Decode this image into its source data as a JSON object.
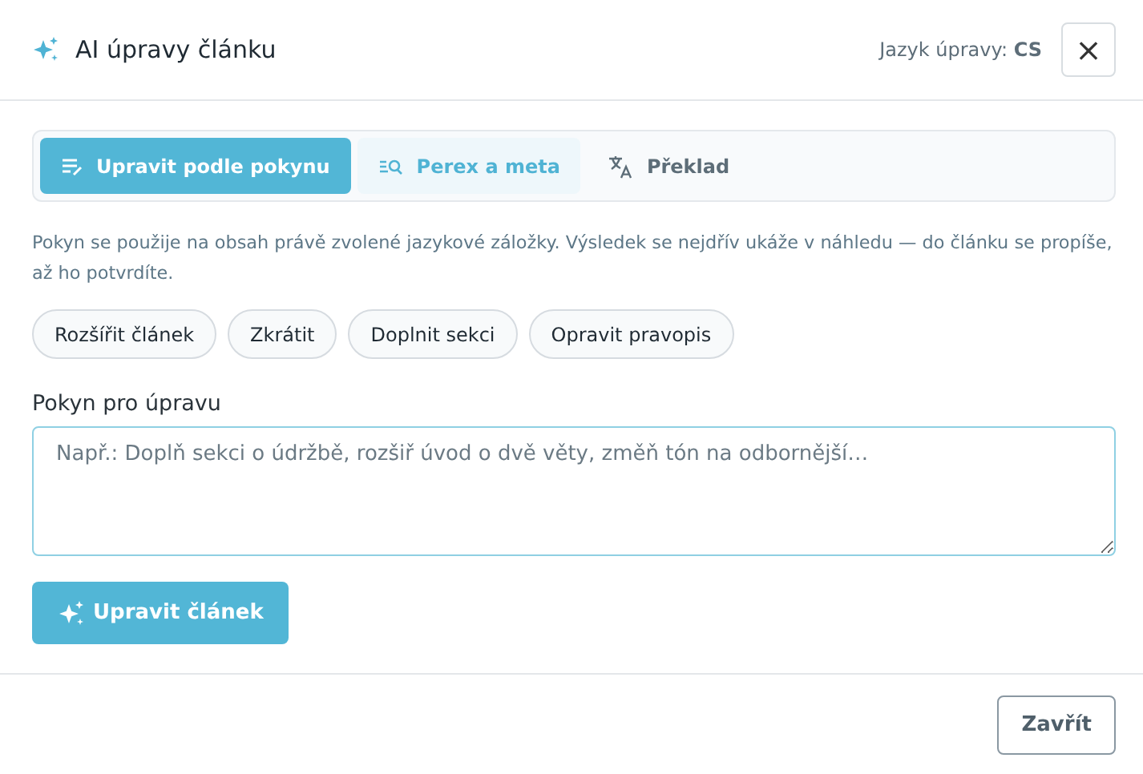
{
  "header": {
    "title": "AI úpravy článku",
    "language_label": "Jazyk úpravy: **CS**",
    "close": "×"
  },
  "tabs": [
    {
      "label": "Upravit podle pokynu",
      "kind": "edit",
      "selected": true,
      "hovered": false
    },
    {
      "label": "Perex a meta",
      "kind": "search",
      "selected": false,
      "hovered": true
    },
    {
      "label": "Překlad",
      "kind": "translate",
      "selected": false,
      "hovered": false
    }
  ],
  "description": "Pokyn se použije na obsah právě zvolené jazykové záložky. Výsledek se nejdřív ukáže v náhledu — do článku se propíše, až ho potvrdíte.",
  "presets": [
    "Rozšířit článek",
    "Zkrátit",
    "Doplnit sekci",
    "Opravit pravopis"
  ],
  "instruction": {
    "label": "Pokyn pro úpravu",
    "placeholder": "Např.: Doplň sekci o údržbě, rozšiř úvod o dvě věty, změň tón na odbornější…"
  },
  "submit": "Upravit článek",
  "footer": {
    "close": "Zavřít"
  }
}
